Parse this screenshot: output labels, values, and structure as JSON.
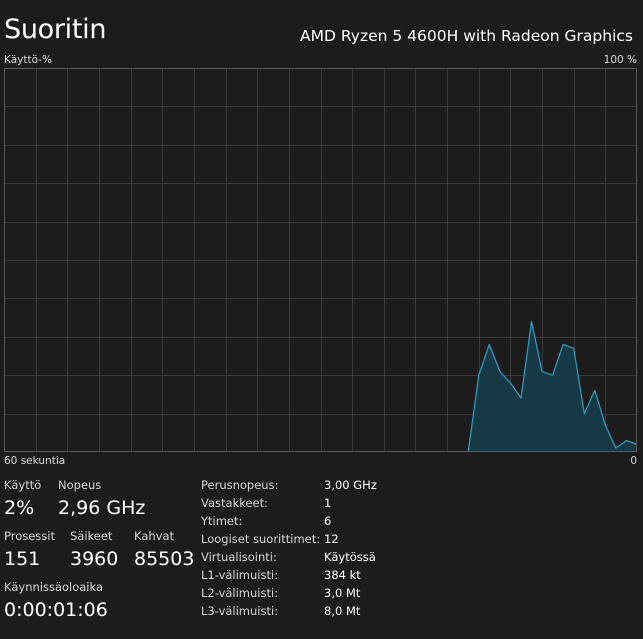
{
  "header": {
    "title": "Suoritin",
    "cpu_name": "AMD Ryzen 5 4600H with Radeon Graphics"
  },
  "graph": {
    "y_label": "Käyttö-%",
    "y_max_label": "100 %",
    "x_label": "60 sekuntia",
    "x_min_label": "0",
    "colors": {
      "line": "#2e9ec7",
      "fill": "#153a45",
      "grid": "#3a3a3a",
      "border": "#5a5a5a",
      "background": "#1c1c1c"
    }
  },
  "chart_data": {
    "type": "area",
    "x": [
      60,
      59,
      58,
      57,
      56,
      55,
      54,
      53,
      52,
      51,
      50,
      49,
      48,
      47,
      46,
      45,
      44,
      43,
      42,
      41,
      40,
      39,
      38,
      37,
      36,
      35,
      34,
      33,
      32,
      31,
      30,
      29,
      28,
      27,
      26,
      25,
      24,
      23,
      22,
      21,
      20,
      19,
      18,
      17,
      16,
      15,
      14,
      13,
      12,
      11,
      10,
      9,
      8,
      7,
      6,
      5,
      4,
      3,
      2,
      1,
      0
    ],
    "values": [
      0,
      0,
      0,
      0,
      0,
      0,
      0,
      0,
      0,
      0,
      0,
      0,
      0,
      0,
      0,
      0,
      0,
      0,
      0,
      0,
      0,
      0,
      0,
      0,
      0,
      0,
      0,
      0,
      0,
      0,
      0,
      0,
      0,
      0,
      0,
      0,
      0,
      0,
      0,
      0,
      0,
      0,
      0,
      0,
      0,
      20,
      28,
      21,
      18,
      14,
      34,
      21,
      20,
      28,
      27,
      10,
      16,
      7,
      1,
      3,
      2
    ],
    "ylim": [
      0,
      100
    ],
    "xlim": [
      60,
      0
    ],
    "grid": true
  },
  "stats": {
    "usage": {
      "label": "Käyttö",
      "value": "2%"
    },
    "speed": {
      "label": "Nopeus",
      "value": "2,96 GHz"
    },
    "processes": {
      "label": "Prosessit",
      "value": "151"
    },
    "threads": {
      "label": "Säikeet",
      "value": "3960"
    },
    "handles": {
      "label": "Kahvat",
      "value": "85503"
    },
    "uptime": {
      "label": "Käynnissäoloaika",
      "value": "0:00:01:06"
    }
  },
  "details": [
    {
      "key": "Perusnopeus:",
      "value": "3,00 GHz"
    },
    {
      "key": "Vastakkeet:",
      "value": "1"
    },
    {
      "key": "Ytimet:",
      "value": "6"
    },
    {
      "key": "Loogiset suorittimet:",
      "value": "12"
    },
    {
      "key": "Virtualisointi:",
      "value": "Käytössä"
    },
    {
      "key": "L1-välimuisti:",
      "value": "384 kt"
    },
    {
      "key": "L2-välimuisti:",
      "value": "3,0 Mt"
    },
    {
      "key": "L3-välimuisti:",
      "value": "8,0 Mt"
    }
  ]
}
